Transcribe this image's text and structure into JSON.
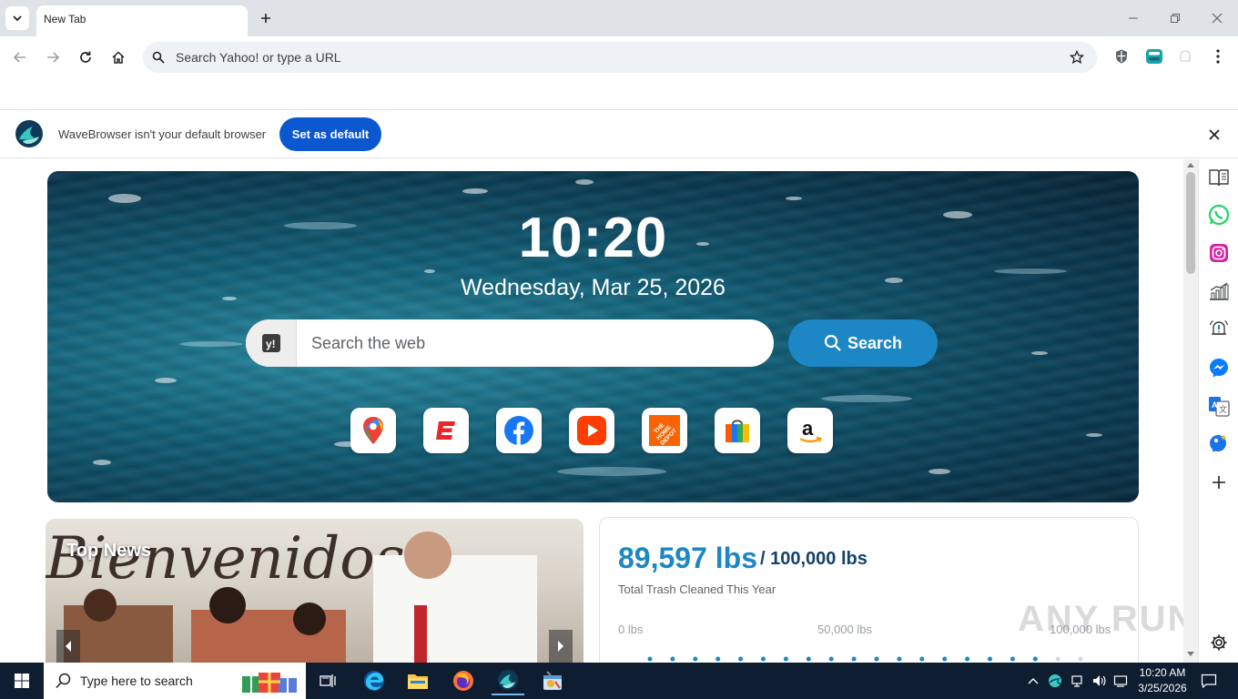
{
  "browser": {
    "tab_title": "New Tab",
    "omnibox_placeholder": "Search Yahoo! or type a URL"
  },
  "infobar": {
    "message": "WaveBrowser isn't your default browser",
    "button_label": "Set as default"
  },
  "newtab": {
    "clock": "10:20",
    "date": "Wednesday, Mar 25, 2026",
    "search_placeholder": "Search the web",
    "search_button": "Search",
    "shortcuts": [
      "google-maps-icon",
      "espn-icon",
      "facebook-icon",
      "youtube-icon",
      "home-depot-icon",
      "shopping-bag-icon",
      "amazon-icon"
    ],
    "news": {
      "title": "Top News"
    },
    "trash": {
      "amount": "89,597 lbs",
      "goal": "/ 100,000 lbs",
      "label": "Total Trash Cleaned This Year",
      "ticks": [
        "0 lbs",
        "50,000 lbs",
        "100,000 lbs"
      ],
      "progress": 0.896
    }
  },
  "sidebar": {
    "icons": [
      "book-icon",
      "whatsapp-icon",
      "instagram-icon",
      "stocks-chart-icon",
      "alert-bell-icon",
      "messenger-icon",
      "translate-icon",
      "wellness-icon",
      "add-icon",
      "settings-icon"
    ]
  },
  "taskbar": {
    "search_placeholder": "Type here to search",
    "time": "10:20 AM",
    "date": "3/25/2026"
  },
  "colors": {
    "accent": "#1d86c4",
    "button_blue": "#0b57d0",
    "trash_goal": "#13426b",
    "taskbar": "#0f1d30"
  },
  "watermark": "ANY RUN"
}
